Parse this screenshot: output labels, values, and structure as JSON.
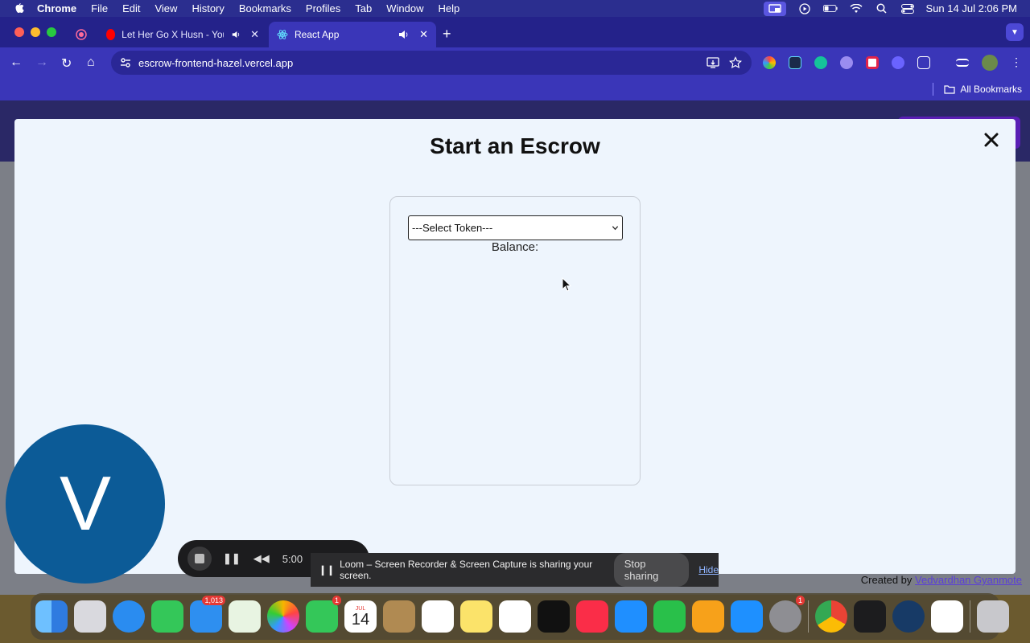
{
  "menubar": {
    "app": "Chrome",
    "items": [
      "File",
      "Edit",
      "View",
      "History",
      "Bookmarks",
      "Profiles",
      "Tab",
      "Window",
      "Help"
    ],
    "clock": "Sun 14 Jul  2:06 PM"
  },
  "tabs": [
    {
      "title": "Let Her Go X Husn - YouTube"
    },
    {
      "title": "React App"
    }
  ],
  "address": {
    "url": "escrow-frontend-hazel.vercel.app"
  },
  "bookmarks": {
    "all_label": "All Bookmarks"
  },
  "modal": {
    "title": "Start an Escrow",
    "select_value": "---Select Token---",
    "balance_label": "Balance:"
  },
  "footer": {
    "created_by": "Created by",
    "author": "Vedvardhan Gyanmote"
  },
  "loom": {
    "avatar_letter": "V",
    "timer": "5:00",
    "share_text": "Loom – Screen Recorder & Screen Capture is sharing your screen.",
    "stop_label": "Stop sharing",
    "hide_label": "Hide"
  },
  "dock": {
    "mail_badge": "1,013",
    "facetime_badge": "1",
    "calendar_month": "JUL",
    "calendar_day": "14",
    "settings_badge": "1"
  }
}
